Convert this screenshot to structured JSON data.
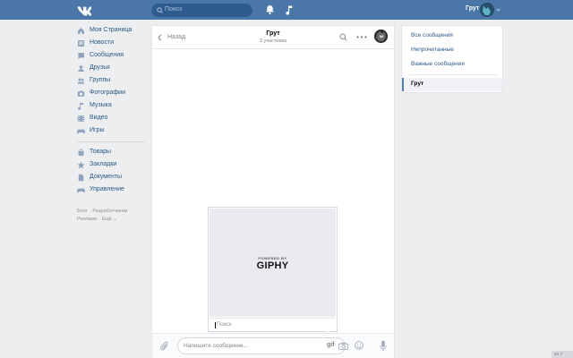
{
  "header": {
    "search_placeholder": "Поиск",
    "user_name": "Грут",
    "accent": "#4a76a8"
  },
  "sidebar": {
    "primary": [
      {
        "label": "Моя Страница",
        "icon": "home-icon"
      },
      {
        "label": "Новости",
        "icon": "news-icon"
      },
      {
        "label": "Сообщения",
        "icon": "messages-icon"
      },
      {
        "label": "Друзья",
        "icon": "friends-icon"
      },
      {
        "label": "Группы",
        "icon": "groups-icon"
      },
      {
        "label": "Фотографии",
        "icon": "camera-icon"
      },
      {
        "label": "Музыка",
        "icon": "music-icon"
      },
      {
        "label": "Видео",
        "icon": "video-icon"
      },
      {
        "label": "Игры",
        "icon": "gamepad-icon"
      }
    ],
    "secondary": [
      {
        "label": "Товары",
        "icon": "bag-icon"
      },
      {
        "label": "Закладки",
        "icon": "star-icon"
      },
      {
        "label": "Документы",
        "icon": "document-icon"
      },
      {
        "label": "Управление",
        "icon": "gamepad-icon"
      }
    ],
    "footer": {
      "blog": "Блог",
      "developers": "Разработчикам",
      "ads": "Реклама",
      "more": "Ещё ⌄"
    }
  },
  "chat": {
    "back_label": "Назад",
    "title": "Грут",
    "subtitle": "3 участника"
  },
  "giphy": {
    "powered_by": "POWERED BY",
    "logo": "GIPHY",
    "search_placeholder": "Поиск"
  },
  "composer": {
    "placeholder": "Напишите сообщение...",
    "gif_label": "gif"
  },
  "filters": {
    "items": [
      "Все сообщения",
      "Непрочитанные",
      "Важные сообщения"
    ],
    "active": "Грут"
  },
  "corner_badge": "10 ⇧"
}
